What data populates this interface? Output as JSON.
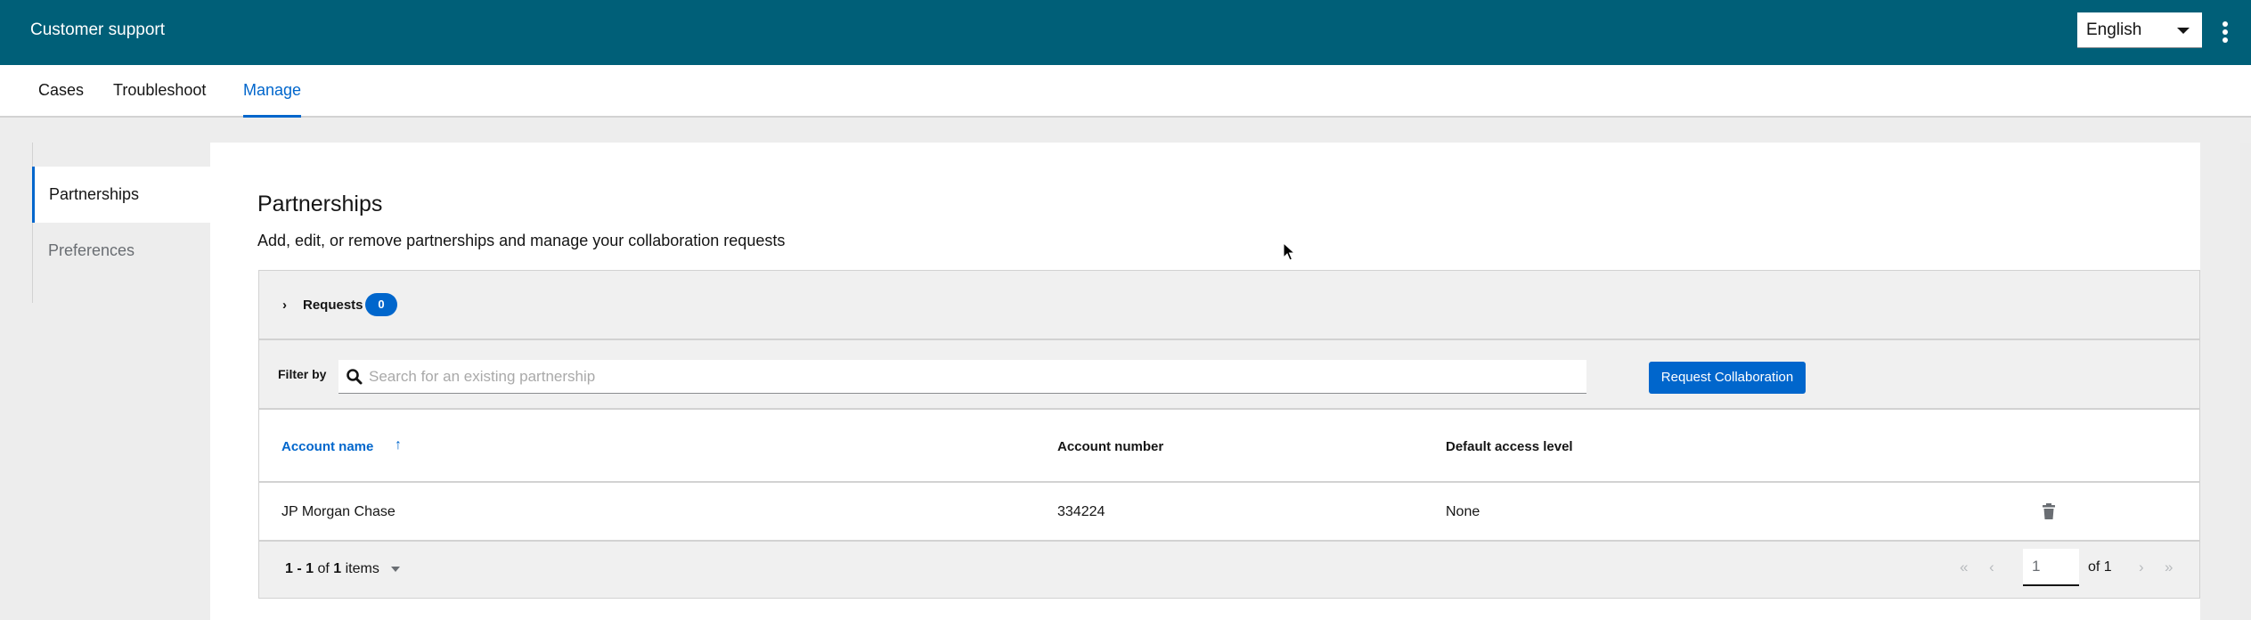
{
  "header": {
    "app_title": "Customer support",
    "language": {
      "selected": "English",
      "icon": "caret-down-icon"
    },
    "overflow_menu_icon": "kebab-icon"
  },
  "tabs": [
    {
      "label": "Cases",
      "active": false
    },
    {
      "label": "Troubleshoot",
      "active": false
    },
    {
      "label": "Manage",
      "active": true
    }
  ],
  "sidebar": {
    "items": [
      {
        "label": "Partnerships",
        "active": true
      },
      {
        "label": "Preferences",
        "active": false
      }
    ]
  },
  "main": {
    "title": "Partnerships",
    "description": "Add, edit, or remove partnerships and manage your collaboration requests",
    "requests": {
      "label": "Requests",
      "count": "0",
      "icon": "chevron-right-icon"
    },
    "filter": {
      "label": "Filter by",
      "search_placeholder": "Search for an existing partnership",
      "search_value": ""
    },
    "request_collaboration_label": "Request Collaboration",
    "table": {
      "columns": [
        {
          "label": "Account name",
          "sortable": true,
          "sort": "ascending"
        },
        {
          "label": "Account number"
        },
        {
          "label": "Default access level"
        }
      ],
      "rows": [
        {
          "account_name": "JP Morgan Chase",
          "account_number": "334224",
          "access_level": "None",
          "action_icon": "trash-icon"
        }
      ]
    },
    "pagination": {
      "range": "1 - 1",
      "of_label": "of",
      "total": "1",
      "items_label": "items",
      "current_page": "1",
      "page_of": "of 1",
      "first": "«",
      "prev": "‹",
      "next": "›",
      "last": "»"
    }
  },
  "colors": {
    "masthead": "#005f78",
    "accent": "#0066cc",
    "surface": "#f0f0f0"
  }
}
